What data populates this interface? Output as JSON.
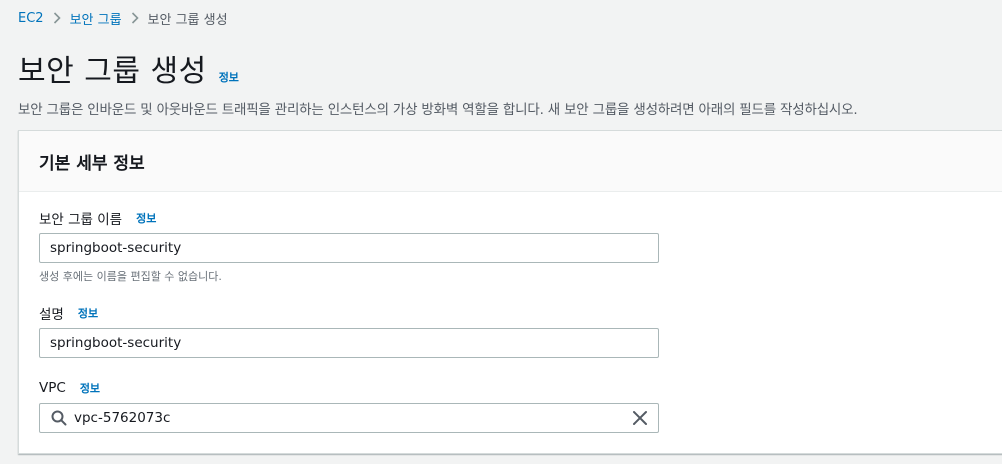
{
  "breadcrumb": {
    "items": [
      "EC2",
      "보안 그룹",
      "보안 그룹 생성"
    ]
  },
  "header": {
    "title": "보안 그룹 생성",
    "info_label": "정보",
    "description": "보안 그룹은 인바운드 및 아웃바운드 트래픽을 관리하는 인스턴스의 가상 방화벽 역할을 합니다. 새 보안 그룹을 생성하려면 아래의 필드를 작성하십시오."
  },
  "basic_details": {
    "title": "기본 세부 정보",
    "name_field": {
      "label": "보안 그룹 이름",
      "info_label": "정보",
      "value": "springboot-security",
      "constraint": "생성 후에는 이름을 편집할 수 없습니다."
    },
    "description_field": {
      "label": "설명",
      "info_label": "정보",
      "value": "springboot-security"
    },
    "vpc_field": {
      "label": "VPC",
      "info_label": "정보",
      "value": "vpc-5762073c"
    }
  },
  "colors": {
    "link": "#0073bb",
    "background": "#f2f3f3",
    "panel": "#ffffff",
    "input_border": "#aab7b8",
    "text": "#16191f",
    "muted": "#545b64"
  },
  "icons": {
    "separator": "chevron-right-icon",
    "search": "search-icon",
    "clear": "close-icon"
  }
}
